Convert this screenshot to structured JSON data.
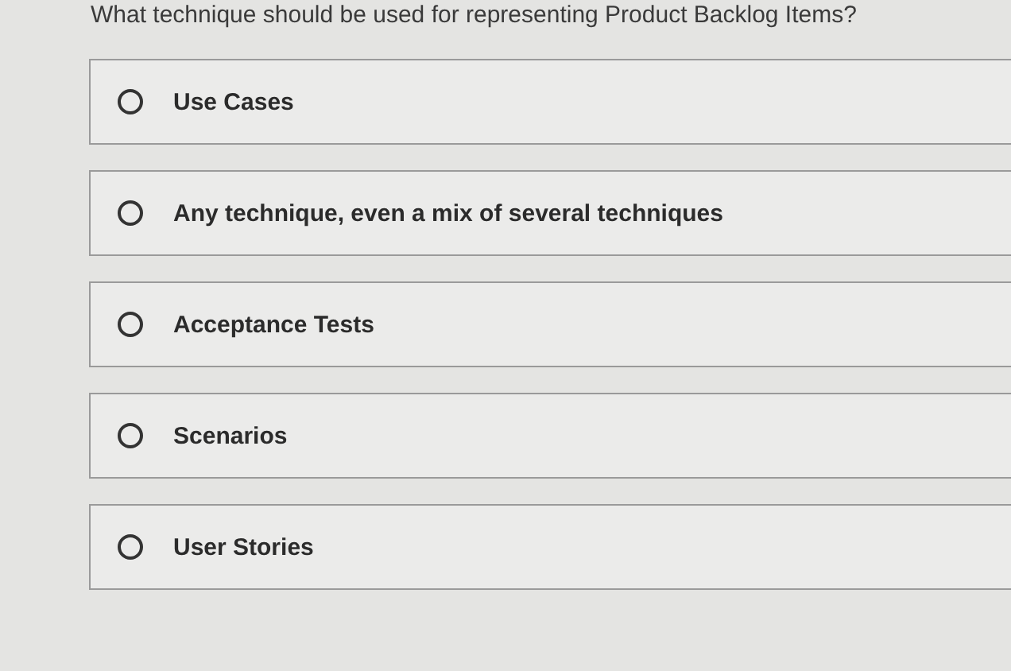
{
  "question": "What technique should be used for representing Product Backlog Items?",
  "options": [
    {
      "label": "Use Cases",
      "selected": false
    },
    {
      "label": "Any technique, even a mix of several techniques",
      "selected": false
    },
    {
      "label": "Acceptance Tests",
      "selected": false
    },
    {
      "label": "Scenarios",
      "selected": false
    },
    {
      "label": "User Stories",
      "selected": false
    }
  ]
}
